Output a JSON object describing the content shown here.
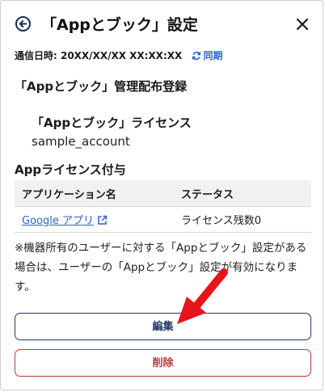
{
  "header": {
    "title": "「Appとブック」設定",
    "back_icon": "back-arrow-icon",
    "close_icon": "close-icon"
  },
  "sync": {
    "label": "通信日時: 20XX/XX/XX XX:XX:XX",
    "link_label": "同期",
    "icon": "refresh-icon"
  },
  "management": {
    "heading": "「Appとブック」管理配布登録"
  },
  "license": {
    "heading": "「Appとブック」ライセンス",
    "account": "sample_account"
  },
  "assignment": {
    "heading": "Appライセンス付与",
    "columns": [
      "アプリケーション名",
      "ステータス"
    ],
    "rows": [
      {
        "app": "Google アプリ",
        "status": "ライセンス残数0"
      }
    ]
  },
  "note": "※機器所有のユーザーに対する「Appとブック」設定がある場合は、ユーザーの「Appとブック」設定が有効になります。",
  "buttons": {
    "edit": "編集",
    "delete": "削除"
  },
  "colors": {
    "link": "#2a62c8",
    "edit_border": "#1f3a66",
    "delete_border": "#b43a3a",
    "annotation_arrow": "#e8141b"
  }
}
